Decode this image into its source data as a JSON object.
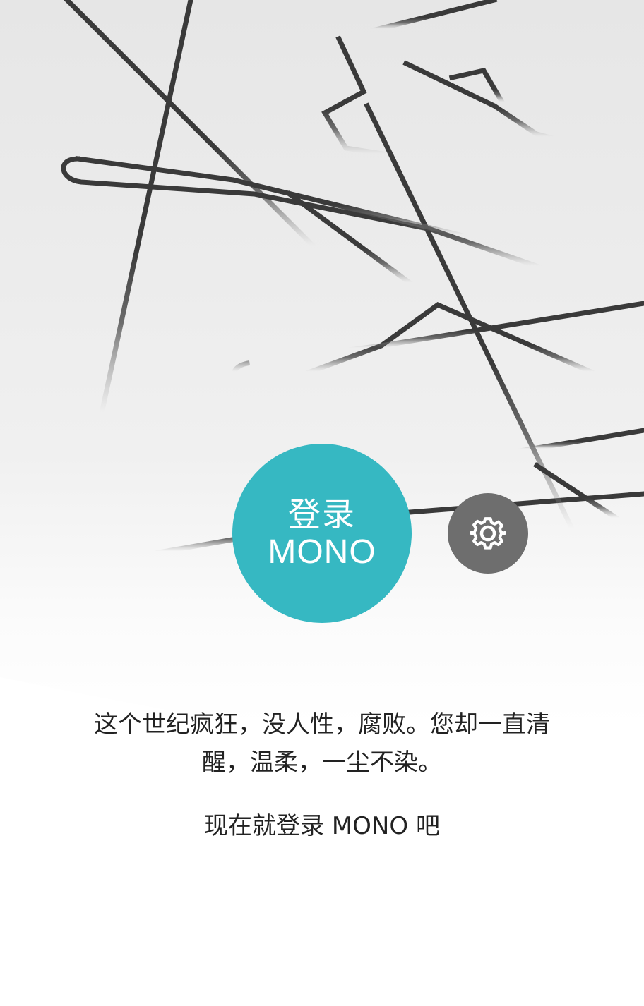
{
  "login_button": {
    "line1": "登录",
    "line2": "MONO",
    "color": "#36b8c2"
  },
  "settings_button": {
    "icon": "gear-icon",
    "color": "#6e6e6e"
  },
  "tagline": "这个世纪疯狂，没人性，腐败。您却一直清醒，温柔，一尘不染。",
  "cta": "现在就登录 MONO 吧"
}
